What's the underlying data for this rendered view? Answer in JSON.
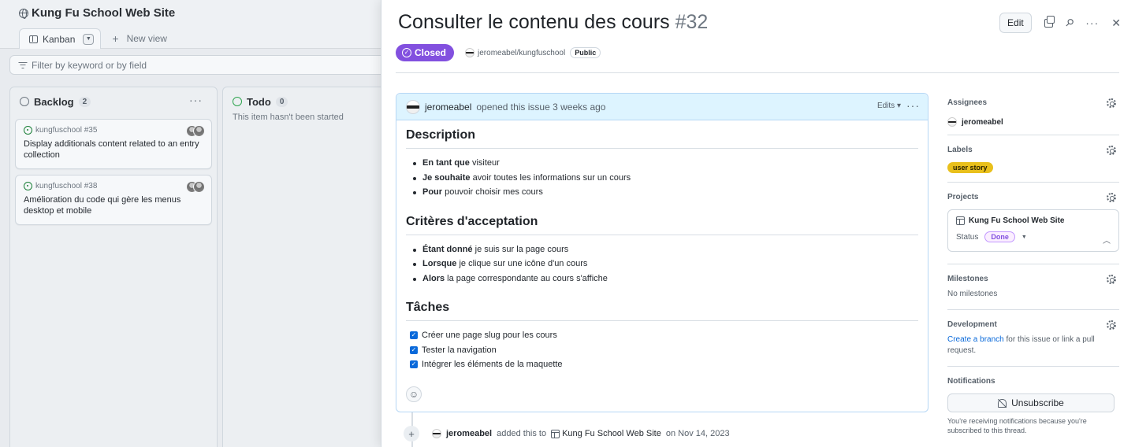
{
  "board": {
    "title": "Kung Fu School Web Site",
    "tabs": [
      {
        "label": "Kanban",
        "icon": "board-icon"
      },
      {
        "label": "New view",
        "icon": "plus-icon"
      }
    ],
    "filter_placeholder": "Filter by keyword or by field",
    "columns": [
      {
        "name": "Backlog",
        "count": "2",
        "status_color": "#6e7781",
        "cards": [
          {
            "ref": "kungfuschool #35",
            "title": "Display additionals content related to an entry collection"
          },
          {
            "ref": "kungfuschool #38",
            "title": "Amélioration du code qui gère les menus desktop et mobile"
          }
        ]
      },
      {
        "name": "Todo",
        "count": "0",
        "status_color": "#2da44e",
        "empty_text": "This item hasn't been started"
      }
    ]
  },
  "issue": {
    "title": "Consulter le contenu des cours",
    "number": "#32",
    "edit_label": "Edit",
    "state": "Closed",
    "state_color": "#8250df",
    "repo": "jeromeabel/kungfuschool",
    "visibility": "Public",
    "comment": {
      "author": "jeromeabel",
      "action": "opened this issue 3 weeks ago",
      "edits_label": "Edits",
      "sections": [
        {
          "heading": "Description",
          "items": [
            {
              "bold": "En tant que",
              "text": " visiteur"
            },
            {
              "bold": "Je souhaite",
              "text": " avoir toutes les informations sur un cours"
            },
            {
              "bold": "Pour",
              "text": " pouvoir choisir mes cours"
            }
          ]
        },
        {
          "heading": "Critères d'acceptation",
          "items": [
            {
              "bold": "Étant donné",
              "text": " je suis sur la page cours"
            },
            {
              "bold": "Lorsque",
              "text": " je clique sur une icône d'un cours"
            },
            {
              "bold": "Alors",
              "text": " la page correspondante au cours s'affiche"
            }
          ]
        },
        {
          "heading": "Tâches",
          "tasks": [
            {
              "text": "Créer une page slug pour les cours",
              "checked": true
            },
            {
              "text": "Tester la navigation",
              "checked": true
            },
            {
              "text": "Intégrer les éléments de la maquette",
              "checked": true
            }
          ]
        }
      ]
    },
    "timeline": {
      "author": "jeromeabel",
      "action": "added this to",
      "project": "Kung Fu School Web Site",
      "date": "on Nov 14, 2023"
    }
  },
  "sidebar": {
    "assignees": {
      "title": "Assignees",
      "value": "jeromeabel"
    },
    "labels": {
      "title": "Labels",
      "value": "user story",
      "color": "#e9c01c"
    },
    "projects": {
      "title": "Projects",
      "project": "Kung Fu School Web Site",
      "status_label": "Status",
      "status": "Done"
    },
    "milestones": {
      "title": "Milestones",
      "value": "No milestones"
    },
    "development": {
      "title": "Development",
      "link": "Create a branch",
      "text": " for this issue or link a pull request."
    },
    "notifications": {
      "title": "Notifications",
      "button": "Unsubscribe",
      "text": "You're receiving notifications because you're subscribed to this thread."
    }
  }
}
